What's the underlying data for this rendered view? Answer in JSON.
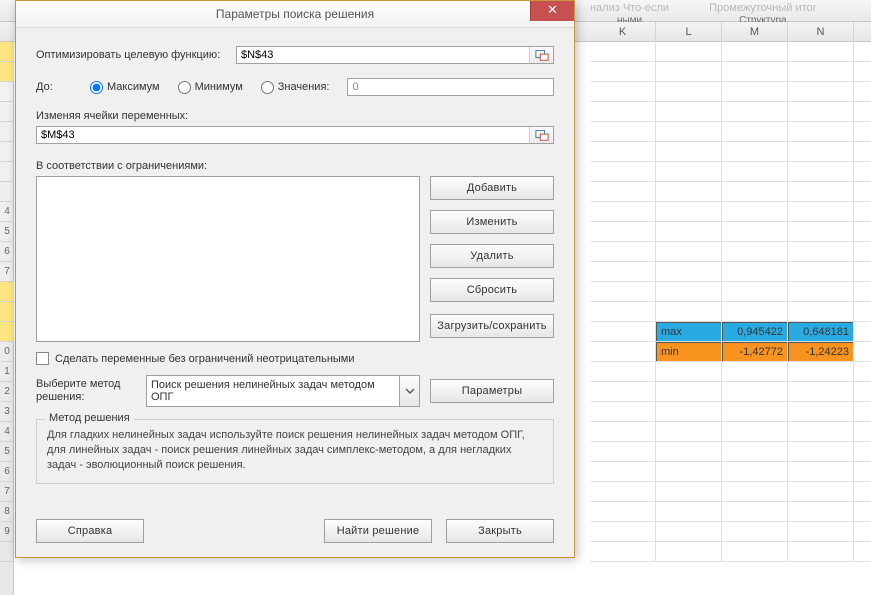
{
  "ribbon": {
    "ghost1": "нализ  Что-если",
    "ghost2": "Промежуточный итог",
    "group1_label": "ными",
    "group2_label": "Структура"
  },
  "columns": [
    "K",
    "L",
    "M",
    "N"
  ],
  "row_numbers": [
    "",
    "",
    "",
    "",
    "",
    "",
    "",
    "",
    "4",
    "5",
    "6",
    "7",
    "",
    "",
    "",
    "0",
    "1",
    "2",
    "3",
    "4",
    "5",
    "6",
    "7",
    "8",
    "9",
    ""
  ],
  "highlighted_rows": [
    0,
    1,
    12,
    13,
    14
  ],
  "cells": {
    "max_label": "max",
    "max_v1": "0,945422",
    "max_v2": "0,648181",
    "min_label": "min",
    "min_v1": "-1,42772",
    "min_v2": "-1,24223"
  },
  "dialog": {
    "title": "Параметры поиска решения",
    "close": "✕",
    "objective_label": "Оптимизировать целевую функцию:",
    "objective_value": "$N$43",
    "to_label": "До:",
    "radio_max": "Максимум",
    "radio_min": "Минимум",
    "radio_value": "Значения:",
    "value_input": "0",
    "vars_label": "Изменяя ячейки переменных:",
    "vars_value": "$M$43",
    "constraints_label": "В соответствии с ограничениями:",
    "btn_add": "Добавить",
    "btn_change": "Изменить",
    "btn_delete": "Удалить",
    "btn_reset": "Сбросить",
    "btn_loadsave": "Загрузить/сохранить",
    "chk_label": "Сделать переменные без ограничений неотрицательными",
    "method_label": "Выберите метод решения:",
    "method_value": "Поиск решения нелинейных задач методом ОПГ",
    "btn_params": "Параметры",
    "fieldset_title": "Метод решения",
    "help_text": "Для гладких нелинейных задач используйте поиск решения нелинейных задач методом ОПГ, для линейных задач - поиск решения линейных задач симплекс-методом, а для негладких задач - эволюционный поиск решения.",
    "btn_help": "Справка",
    "btn_solve": "Найти решение",
    "btn_close": "Закрыть"
  }
}
